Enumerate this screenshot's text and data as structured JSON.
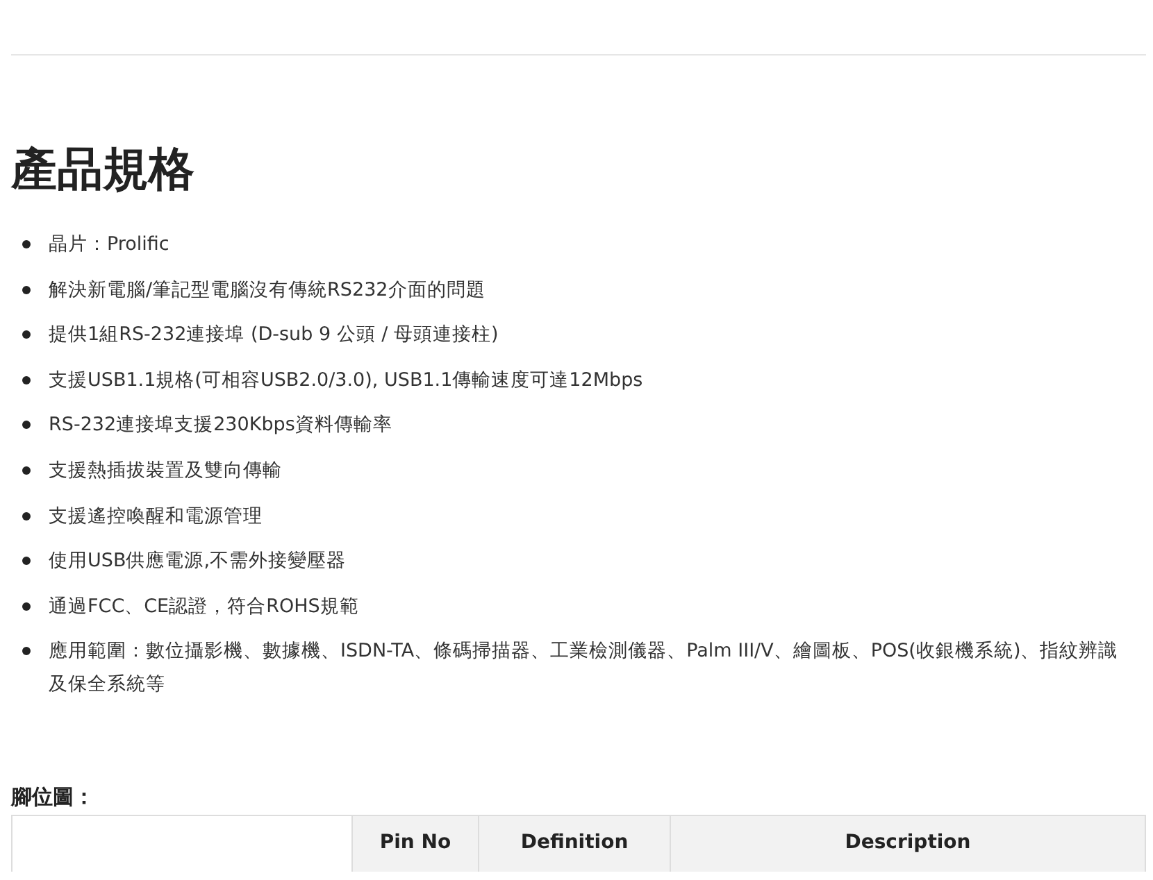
{
  "title": "產品規格",
  "specs": [
    "晶片：Prolific",
    "解決新電腦/筆記型電腦沒有傳統RS232介面的問題",
    "提供1組RS-232連接埠 (D-sub 9 公頭 / 母頭連接柱)",
    "支援USB1.1規格(可相容USB2.0/3.0), USB1.1傳輸速度可達12Mbps",
    "RS-232連接埠支援230Kbps資料傳輸率",
    "支援熱插拔裝置及雙向傳輸",
    "支援遙控喚醒和電源管理",
    "使用USB供應電源,不需外接變壓器",
    "通過FCC、CE認證，符合ROHS規範",
    "應用範圍：數位攝影機、數據機、ISDN-TA、條碼掃描器、工業檢測儀器、Palm III/V、繪圖板、POS(收銀機系統)、指紋辨識及保全系統等"
  ],
  "pinout": {
    "label": "腳位圖：",
    "columns": [
      {
        "kind": "blank"
      },
      {
        "kind": "text",
        "label": "Pin No"
      },
      {
        "kind": "text",
        "label": "Definition"
      },
      {
        "kind": "text",
        "label": "Description"
      }
    ]
  }
}
